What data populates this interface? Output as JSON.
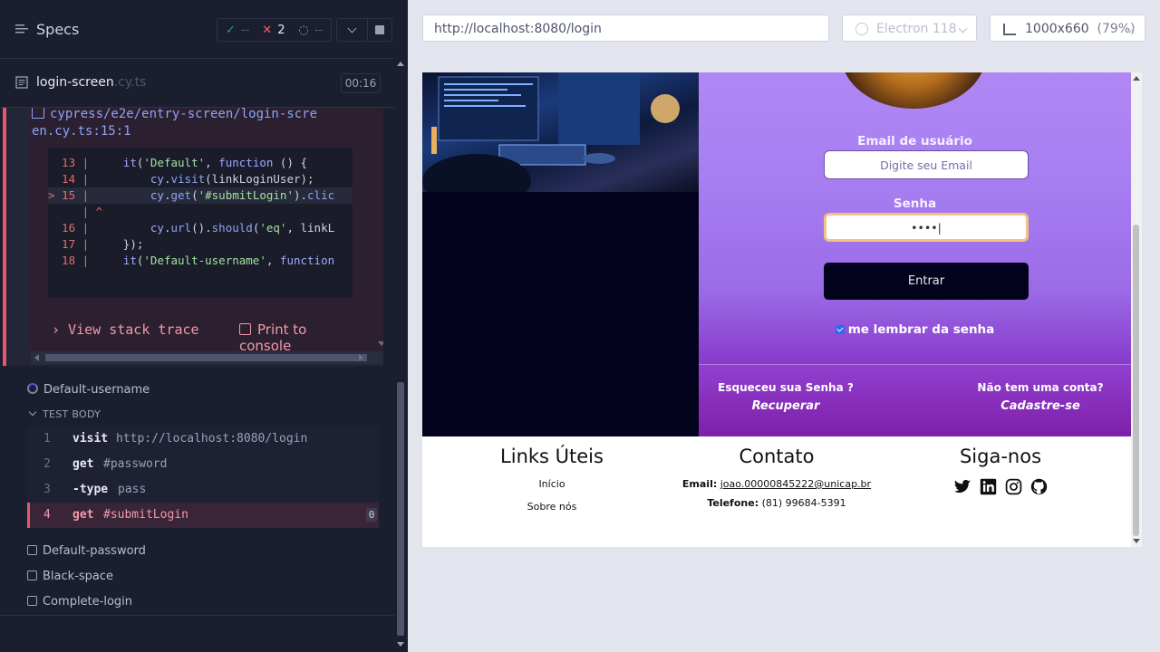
{
  "reporter": {
    "title": "Specs",
    "stats": {
      "passed_icon": "check-icon",
      "passed": "--",
      "failed": "2",
      "pending": "--"
    },
    "spec": {
      "name": "login-screen",
      "ext": ".cy.ts",
      "duration": "00:16"
    },
    "error": {
      "file": "cypress/e2e/entry-screen/login-scre en.cy.ts:15:1",
      "code_lines": [
        {
          "num": "13",
          "marker": " ",
          "code": "    it('Default', function () {"
        },
        {
          "num": "14",
          "marker": " ",
          "code": "        cy.visit(linkLoginUser);"
        },
        {
          "num": "15",
          "marker": ">",
          "code": "        cy.get('#submitLogin').clic"
        },
        {
          "num": "",
          "marker": " ",
          "code": "^"
        },
        {
          "num": "16",
          "marker": " ",
          "code": "        cy.url().should('eq', linkL"
        },
        {
          "num": "17",
          "marker": " ",
          "code": "    });"
        },
        {
          "num": "18",
          "marker": " ",
          "code": "    it('Default-username', function"
        }
      ],
      "view_stack_trace": "View stack trace",
      "print_to_console": "Print to console"
    },
    "tests": {
      "running": "Default-username",
      "test_body_header": "TEST BODY",
      "commands": [
        {
          "num": "1",
          "name": "visit",
          "arg": "http://localhost:8080/login"
        },
        {
          "num": "2",
          "name": "get",
          "arg": "#password"
        },
        {
          "num": "3",
          "name": "-type",
          "arg": "pass"
        },
        {
          "num": "4",
          "name": "get",
          "arg": "#submitLogin",
          "count": "0"
        }
      ],
      "others": [
        "Default-password",
        "Black-space",
        "Complete-login"
      ]
    }
  },
  "aut": {
    "url": "http://localhost:8080/login",
    "browser": "Electron 118",
    "viewport": "1000x660",
    "viewport_pct": "(79%)",
    "login": {
      "email_label": "Email de usuário",
      "email_placeholder": "Digite seu Email",
      "password_label": "Senha",
      "password_value": "••••|",
      "submit": "Entrar",
      "remember": "me lembrar da senha",
      "forgot_q": "Esqueceu sua Senha ?",
      "forgot_a": "Recuperar",
      "signup_q": "Não tem uma conta?",
      "signup_a": "Cadastre-se"
    },
    "footer": {
      "links_title": "Links Úteis",
      "links": [
        "Início",
        "Sobre nós"
      ],
      "contact_title": "Contato",
      "email_label": "Email:",
      "email_value": "joao.00000845222@unicap.br",
      "phone_label": "Telefone:",
      "phone_value": "(81) 99684-5391",
      "follow_title": "Siga-nos",
      "social_icons": [
        "twitter-icon",
        "linkedin-icon",
        "instagram-icon",
        "github-icon"
      ]
    }
  }
}
